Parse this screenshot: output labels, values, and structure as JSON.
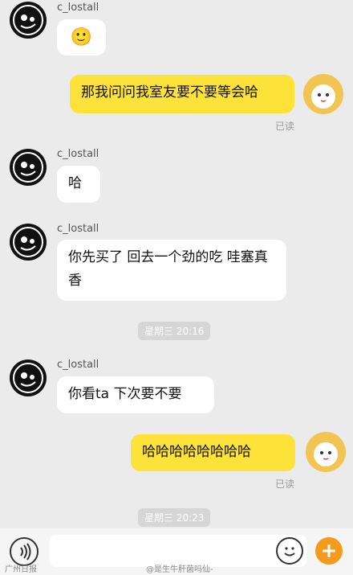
{
  "messages": [
    {
      "sender": "c_lostall",
      "text": "🙂"
    },
    {
      "sender": "me",
      "text": "那我问问我室友要不要等会哈",
      "status": "已读"
    },
    {
      "sender": "c_lostall",
      "text": "哈"
    },
    {
      "sender": "c_lostall",
      "text": "你先买了  回去一个劲的吃  哇塞真香"
    },
    {
      "timestamp": "星期三 20:16"
    },
    {
      "sender": "c_lostall",
      "text": "你看ta  下次要不要"
    },
    {
      "sender": "me",
      "text": "哈哈哈哈哈哈哈哈",
      "status": "已读"
    },
    {
      "timestamp": "星期三 20:23"
    }
  ],
  "watermark": {
    "left": "广州日报",
    "right": "@是生牛肝菌吗仙-"
  },
  "colors": {
    "background": "#ebebeb",
    "my_bubble": "#fde23a",
    "their_bubble": "#ffffff",
    "plus_button": "#f59a1b"
  },
  "icons": {
    "voice": "voice-icon",
    "emoji": "emoji-icon",
    "plus": "plus-icon"
  }
}
